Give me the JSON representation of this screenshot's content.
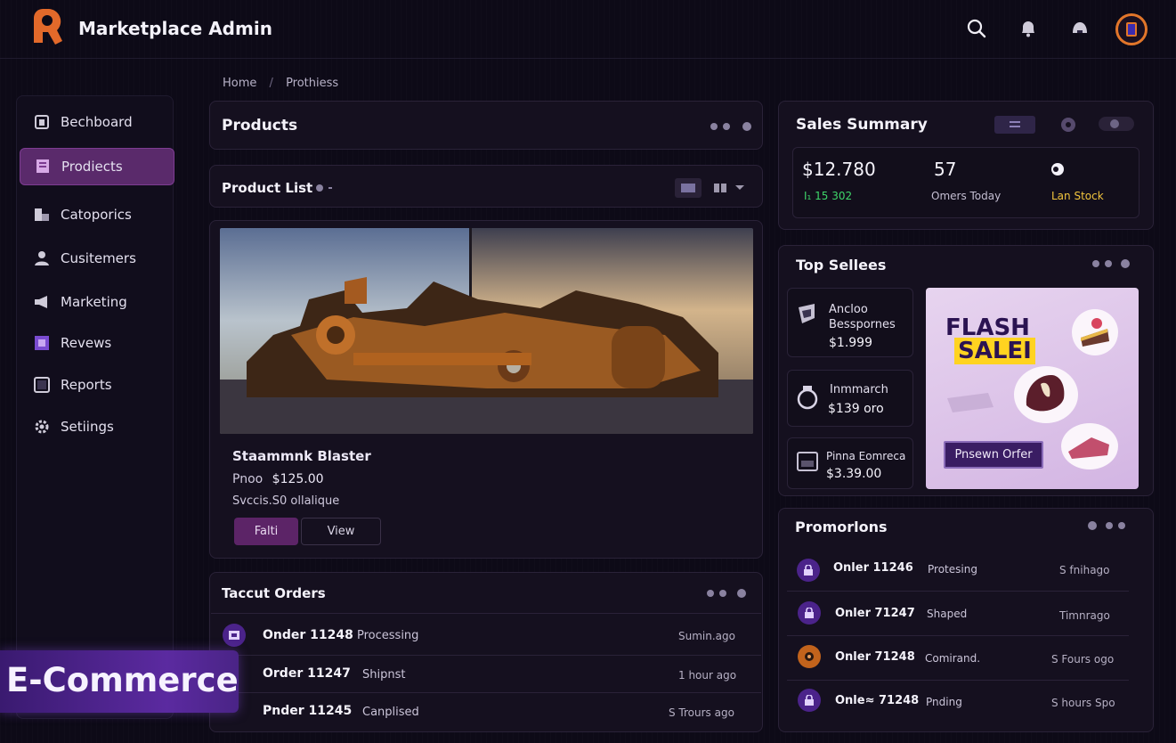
{
  "app": {
    "title": "Marketplace Admin"
  },
  "header": {
    "icons": [
      "search-icon",
      "bell-icon",
      "chat-icon"
    ],
    "avatar": "user-avatar"
  },
  "breadcrumb": {
    "home": "Home",
    "sep": "/",
    "current": "Prothiess"
  },
  "sidebar": {
    "items": [
      {
        "label": "Bechboard",
        "icon": "dashboard-icon"
      },
      {
        "label": "Prodiects",
        "icon": "products-icon",
        "active": true
      },
      {
        "label": "Catoporics",
        "icon": "categories-icon"
      },
      {
        "label": "Cusitemers",
        "icon": "customers-icon"
      },
      {
        "label": "Marketing",
        "icon": "megaphone-icon"
      },
      {
        "label": "Revews",
        "icon": "reviews-icon"
      },
      {
        "label": "Reports",
        "icon": "reports-icon"
      },
      {
        "label": "Setiings",
        "icon": "gear-icon"
      }
    ]
  },
  "products_panel": {
    "title": "Products"
  },
  "product_list": {
    "title": "Product List",
    "product": {
      "name": "Staammnk Blaster",
      "price_label": "Pnoo",
      "price": "$125.00",
      "stock": "Svccis.S0 ollalique",
      "edit_label": "Falti",
      "view_label": "View"
    }
  },
  "orders": {
    "title": "Taccut Orders",
    "rows": [
      {
        "id": "Onder 11248",
        "status": "Processing",
        "time": "Sumin.ago"
      },
      {
        "id": "Order 11247",
        "status": "Shipnst",
        "time": "1 hour ago"
      },
      {
        "id": "Pnder 11245",
        "status": "Canplised",
        "time": "S Trours ago"
      }
    ]
  },
  "sales_summary": {
    "title": "Sales Summary",
    "revenue": "$12.780",
    "revenue_delta": "I₁ 15 302",
    "orders": "57",
    "orders_label": "Omers Today",
    "low_stock_label": "Lan Stock",
    "colors": {
      "positive": "#3fd66a",
      "warning": "#f2c53d"
    }
  },
  "top_sellers": {
    "title": "Top Sellees",
    "items": [
      {
        "name": "Ancloo\nBesspornes",
        "price": "$1.999"
      },
      {
        "name": "Inmmarch",
        "price": "$139 oro"
      },
      {
        "name": "Pinna Eomreca",
        "price": "$3.39.00"
      }
    ],
    "flash": {
      "line1": "FLASH",
      "line2": "SALEI",
      "button": "Pnsewn Orfer"
    }
  },
  "promotions": {
    "title": "Promorlons",
    "rows": [
      {
        "id": "Onler 11246",
        "status": "Protesing",
        "time": "S fnihago"
      },
      {
        "id": "Onler 71247",
        "status": "Shaped",
        "time": "Timnrago"
      },
      {
        "id": "Onler 71248",
        "status": "Comirand.",
        "time": "S Fours ogo"
      },
      {
        "id": "Onle≈ 71248",
        "status": "Pnding",
        "time": "S hours Spo"
      }
    ]
  },
  "banner": {
    "label": "E-Commerce"
  }
}
